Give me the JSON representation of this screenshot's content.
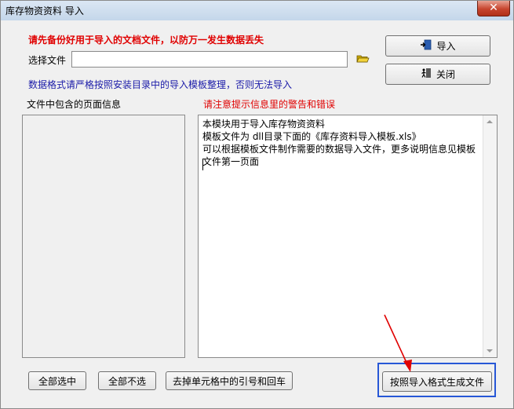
{
  "window": {
    "title": "库存物资资料 导入",
    "close_glyph": "✕"
  },
  "warning_backup": "请先备份好用于导入的文档文件，以防万一发生数据丢失",
  "file": {
    "label": "选择文件",
    "value": ""
  },
  "format_note": "数据格式请严格按照安装目录中的导入模板整理，否则无法导入",
  "buttons": {
    "import": "导入",
    "close": "关闭",
    "select_all": "全部选中",
    "deselect_all": "全部不选",
    "strip_quotes": "去掉单元格中的引号和回车",
    "generate": "按照导入格式生成文件"
  },
  "pages_label": "文件中包含的页面信息",
  "attention_label": "请注意提示信息里的警告和错误",
  "info_lines": [
    "本模块用于导入库存物资资料",
    "模板文件为 dll目录下面的《库存资料导入模板.xls》",
    "可以根据模板文件制作需要的数据导入文件，更多说明信息见模板",
    "文件第一页面"
  ],
  "icons": {
    "folder": "folder-open-icon",
    "import": "import-door-icon",
    "close": "exit-icon"
  },
  "colors": {
    "warning": "#e00000",
    "note": "#1a1aa8",
    "annotation": "#2757d6"
  }
}
